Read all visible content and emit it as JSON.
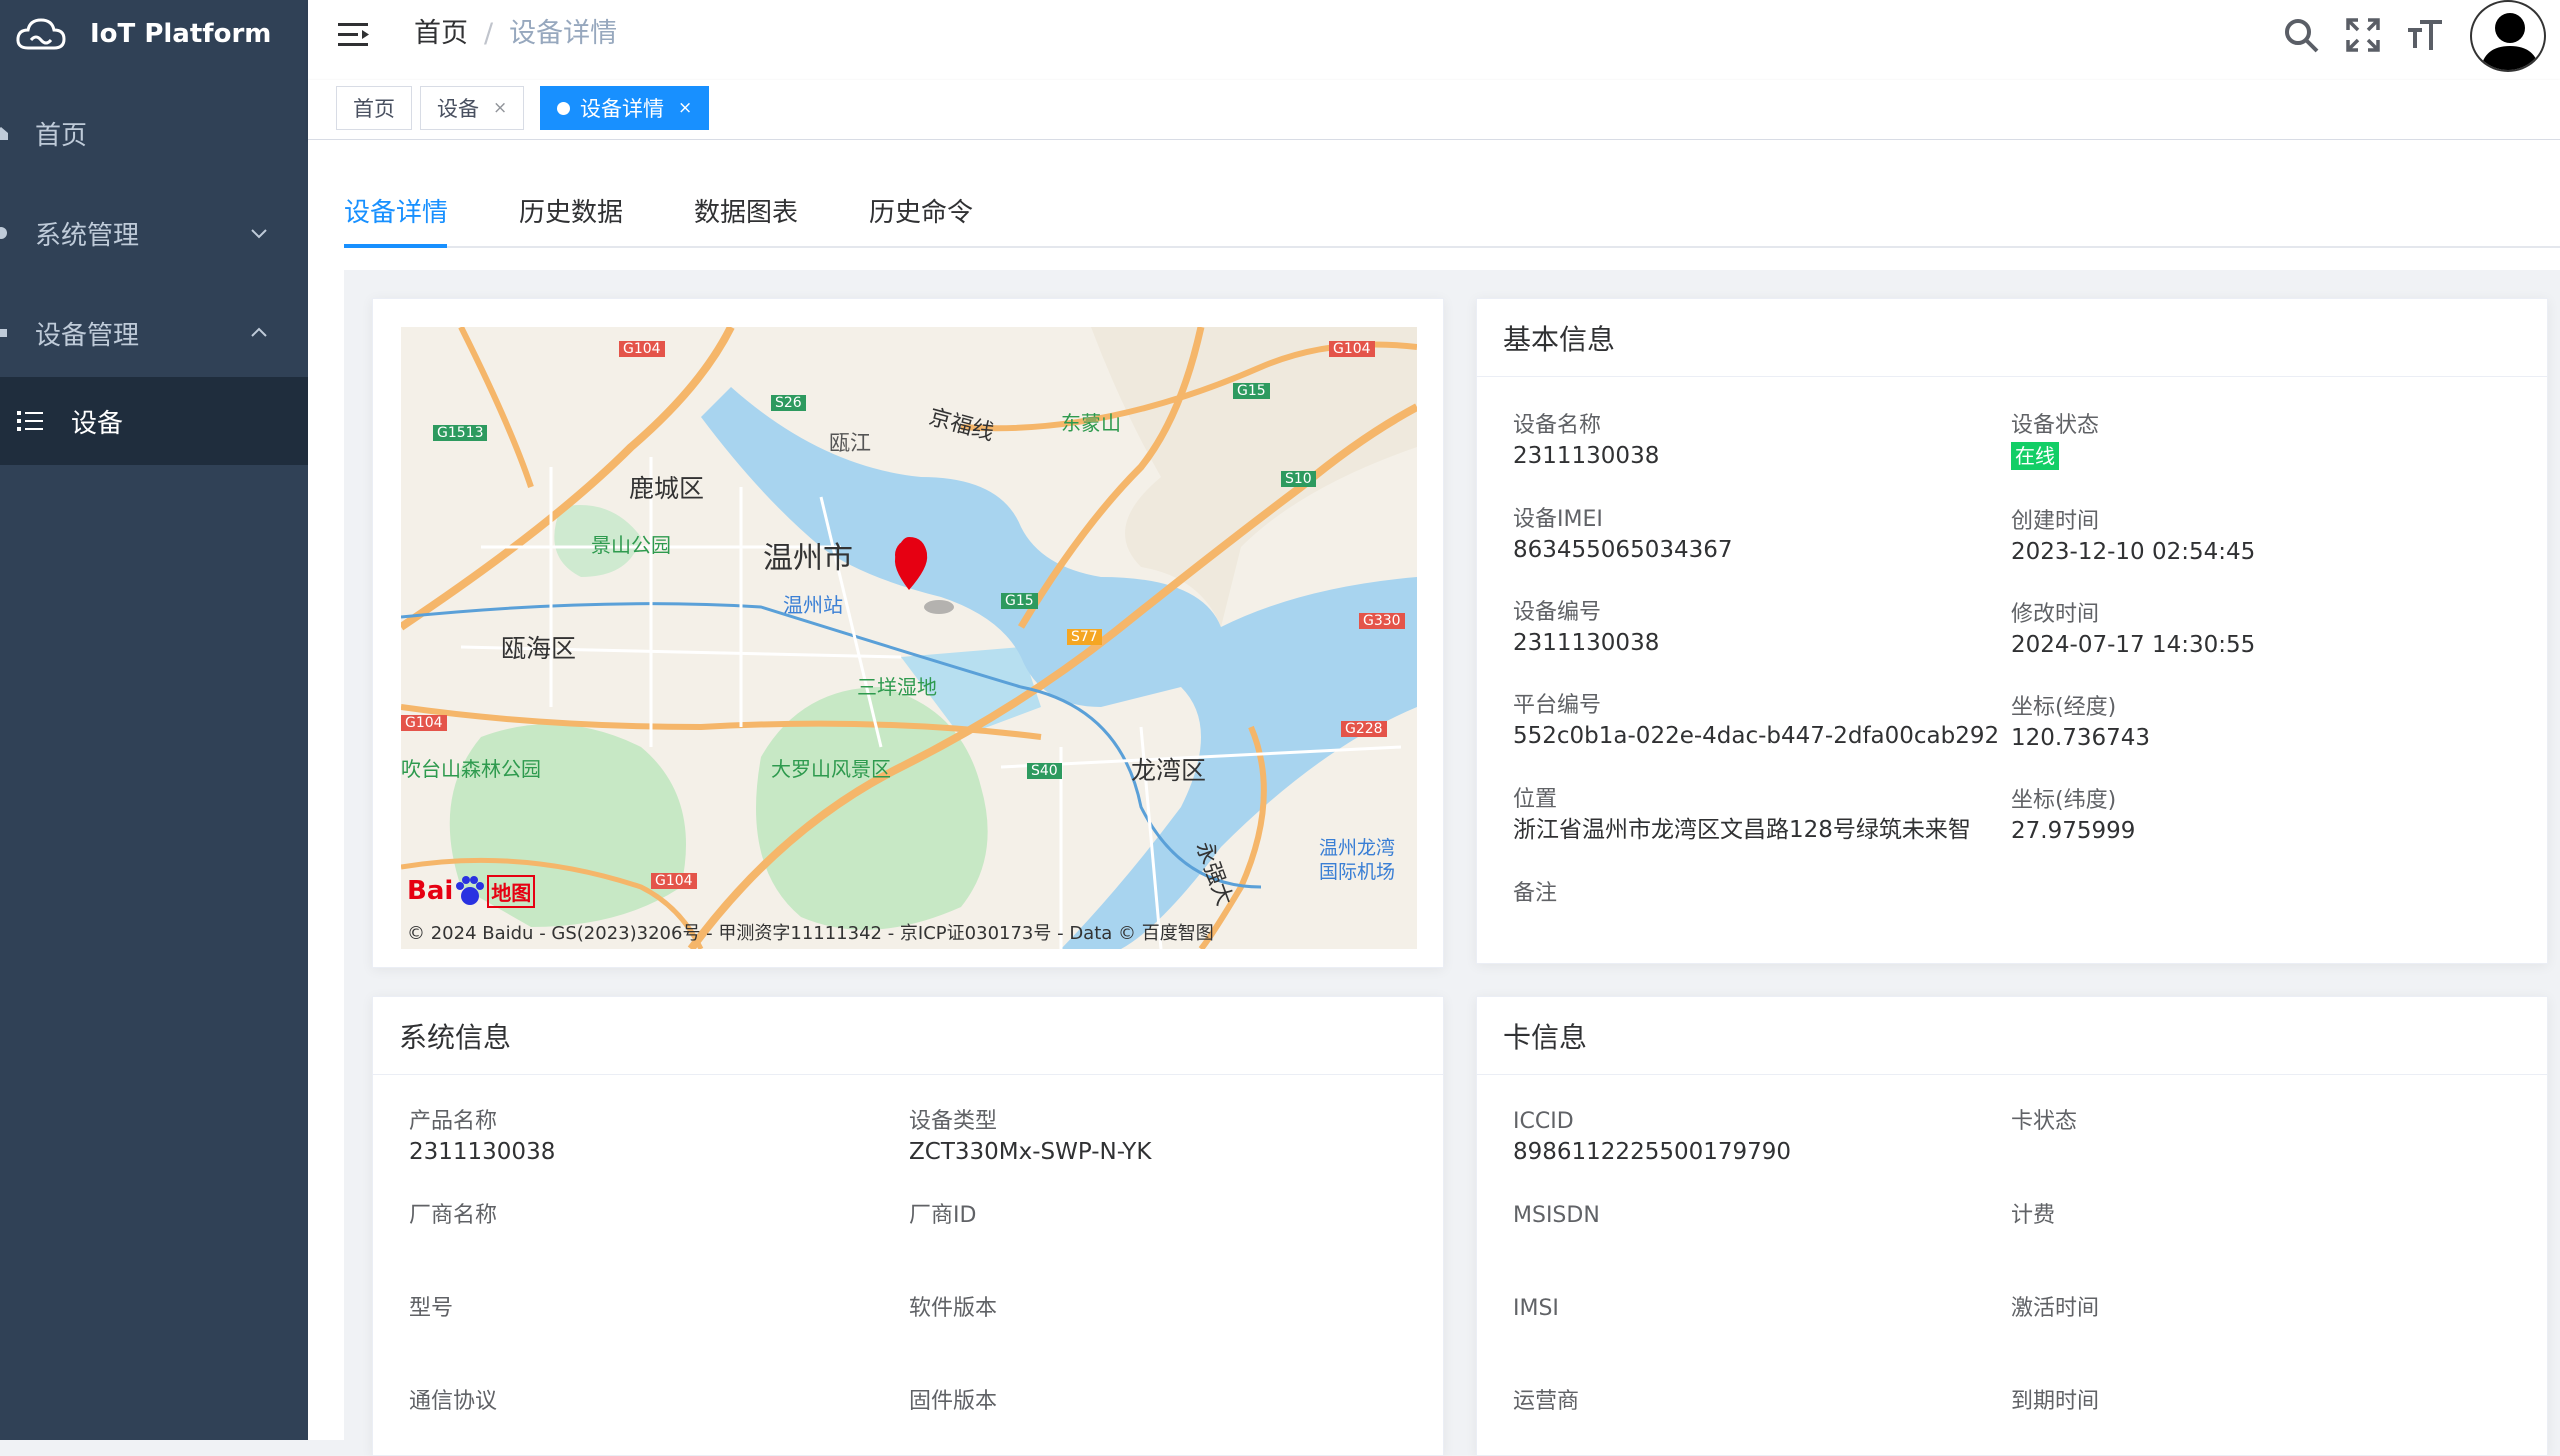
{
  "app": {
    "title": "IoT Platform"
  },
  "sidebar": {
    "items": [
      {
        "label": "首页"
      },
      {
        "label": "系统管理"
      },
      {
        "label": "设备管理"
      }
    ],
    "sub_item": {
      "label": "设备"
    }
  },
  "navbar": {
    "breadcrumb": {
      "home": "首页",
      "separator": "/",
      "current": "设备详情"
    }
  },
  "tags": [
    {
      "label": "首页"
    },
    {
      "label": "设备",
      "close": "×"
    },
    {
      "label": "设备详情",
      "close": "×"
    }
  ],
  "tabs": [
    {
      "label": "设备详情"
    },
    {
      "label": "历史数据"
    },
    {
      "label": "数据图表"
    },
    {
      "label": "历史命令"
    }
  ],
  "map": {
    "labels": {
      "wenzhou": "温州市",
      "lucheng": "鹿城区",
      "ouhai": "瓯海区",
      "longwan": "龙湾区",
      "oujiang": "瓯江",
      "jingfu": "京福线",
      "dongmeng": "东蒙山",
      "jingshan": "景山公园",
      "station": "温州站",
      "sanyang": "三垟湿地",
      "daluo": "大罗山风景区",
      "chuitai": "吹台山森林公园",
      "airport_1": "温州龙湾",
      "airport_2": "国际机场",
      "yongqiang": "永强大"
    },
    "roads": [
      "G104",
      "G104",
      "G1513",
      "S26",
      "G15",
      "S10",
      "G15",
      "S77",
      "G330",
      "G104",
      "G228",
      "S40",
      "G104"
    ],
    "logo_text": "Bai",
    "logo_text_2": "地图",
    "copyright": "© 2024 Baidu - GS(2023)3206号 - 甲测资字11111342 - 京ICP证030173号 - Data © 百度智图"
  },
  "basic_info": {
    "title": "基本信息",
    "device_name_label": "设备名称",
    "device_name": "2311130038",
    "status_label": "设备状态",
    "status": "在线",
    "imei_label": "设备IMEI",
    "imei": "863455065034367",
    "created_label": "创建时间",
    "created": "2023-12-10 02:54:45",
    "code_label": "设备编号",
    "code": "2311130038",
    "modified_label": "修改时间",
    "modified": "2024-07-17 14:30:55",
    "platform_label": "平台编号",
    "platform": "552c0b1a-022e-4dac-b447-2dfa00cab292",
    "lng_label": "坐标(经度)",
    "lng": "120.736743",
    "location_label": "位置",
    "location": "浙江省温州市龙湾区文昌路128号绿筑未来智",
    "lat_label": "坐标(纬度)",
    "lat": "27.975999",
    "remark_label": "备注"
  },
  "system_info": {
    "title": "系统信息",
    "product_label": "产品名称",
    "product": "2311130038",
    "type_label": "设备类型",
    "type": "ZCT330Mx-SWP-N-YK",
    "vendor_label": "厂商名称",
    "vendor_id_label": "厂商ID",
    "model_label": "型号",
    "software_label": "软件版本",
    "protocol_label": "通信协议",
    "firmware_label": "固件版本"
  },
  "card_info": {
    "title": "卡信息",
    "iccid_label": "ICCID",
    "iccid": "89861122255001797​90",
    "card_status_label": "卡状态",
    "msisdn_label": "MSISDN",
    "billing_label": "计费",
    "imsi_label": "IMSI",
    "activated_label": "激活时间",
    "carrier_label": "运营商",
    "expire_label": "到期时间"
  },
  "colors": {
    "primary": "#1890ff",
    "sidebar": "#304156",
    "online": "#13ce66"
  }
}
